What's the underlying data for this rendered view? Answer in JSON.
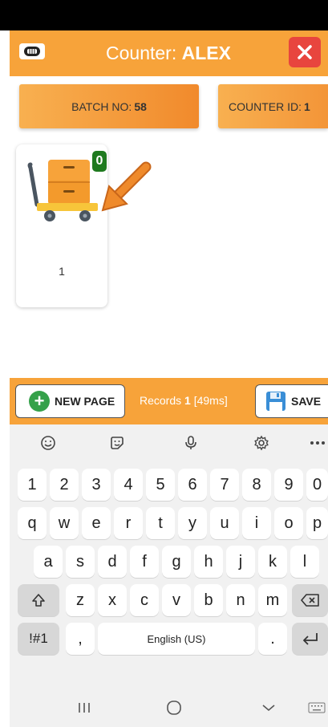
{
  "header": {
    "title_prefix": "Counter: ",
    "title_name": "ALEX",
    "logo_icon": "cash-register-icon",
    "close_icon": "close-icon"
  },
  "info": {
    "batch_label": "BATCH NO:",
    "batch_value": "58",
    "counter_label": "COUNTER ID:",
    "counter_value": "1"
  },
  "card": {
    "badge": "0",
    "label": "1",
    "icon": "cart-icon",
    "arrow_icon": "arrow-pointer-icon"
  },
  "actions": {
    "new_page_label": "NEW PAGE",
    "records_prefix": "Records ",
    "records_count": "1",
    "records_time": " [49ms]",
    "save_label": "SAVE"
  },
  "keyboard": {
    "row1": [
      "1",
      "2",
      "3",
      "4",
      "5",
      "6",
      "7",
      "8",
      "9",
      "0"
    ],
    "row2": [
      "q",
      "w",
      "e",
      "r",
      "t",
      "y",
      "u",
      "i",
      "o",
      "p"
    ],
    "row3": [
      "a",
      "s",
      "d",
      "f",
      "g",
      "h",
      "j",
      "k",
      "l"
    ],
    "row4": [
      "z",
      "x",
      "c",
      "v",
      "b",
      "n",
      "m"
    ],
    "symbols_label": "!#1",
    "comma_label": ",",
    "space_label": "English (US)",
    "period_label": "."
  },
  "colors": {
    "accent": "#f7a33a",
    "close": "#e8453e",
    "badge": "#1f7a1f",
    "plus": "#35a14a"
  }
}
